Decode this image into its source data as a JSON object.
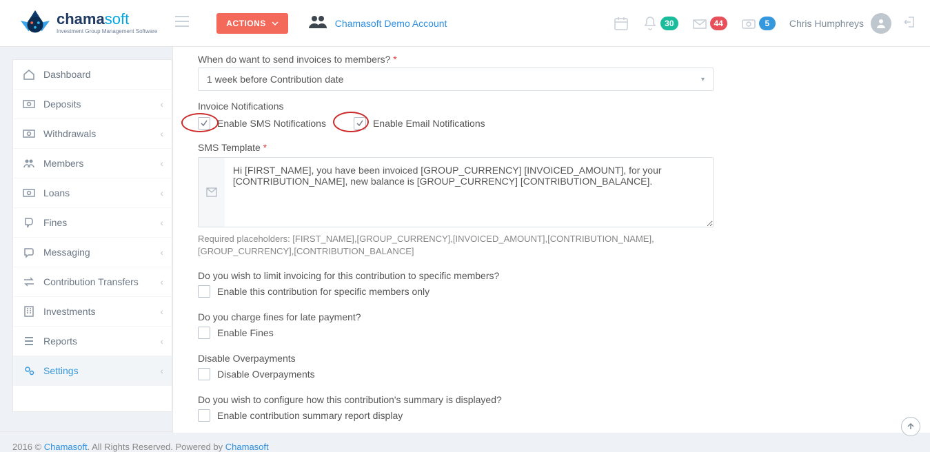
{
  "header": {
    "brand": "chamasoft",
    "brand_sub": "Investment Group Management Software",
    "actions_label": "ACTIONS",
    "account_name": "Chamasoft Demo Account",
    "user_name": "Chris Humphreys",
    "badges": {
      "bell": "30",
      "inbox": "44",
      "wallet": "5"
    }
  },
  "sidebar": {
    "items": [
      {
        "label": "Dashboard"
      },
      {
        "label": "Deposits"
      },
      {
        "label": "Withdrawals"
      },
      {
        "label": "Members"
      },
      {
        "label": "Loans"
      },
      {
        "label": "Fines"
      },
      {
        "label": "Messaging"
      },
      {
        "label": "Contribution Transfers"
      },
      {
        "label": "Investments"
      },
      {
        "label": "Reports"
      },
      {
        "label": "Settings"
      }
    ]
  },
  "form": {
    "when_label": "When do want to send invoices to members?",
    "when_value": "1 week before Contribution date",
    "invoice_notifications_label": "Invoice Notifications",
    "enable_sms_label": "Enable SMS Notifications",
    "enable_email_label": "Enable Email Notifications",
    "sms_template_label": "SMS Template",
    "sms_template_value": "Hi [FIRST_NAME], you have been invoiced [GROUP_CURRENCY] [INVOICED_AMOUNT], for your [CONTRIBUTION_NAME], new balance is [GROUP_CURRENCY] [CONTRIBUTION_BALANCE].",
    "sms_hint": "Required placeholders: [FIRST_NAME],[GROUP_CURRENCY],[INVOICED_AMOUNT],[CONTRIBUTION_NAME],[GROUP_CURRENCY],[CONTRIBUTION_BALANCE]",
    "limit_q": "Do you wish to limit invoicing for this contribution to specific members?",
    "limit_cb": "Enable this contribution for specific members only",
    "fines_q": "Do you charge fines for late payment?",
    "fines_cb": "Enable Fines",
    "over_q": "Disable Overpayments",
    "over_cb": "Disable Overpayments",
    "summary_q": "Do you wish to configure how this contribution's summary is displayed?",
    "summary_cb": "Enable contribution summary report display"
  },
  "footer": {
    "year": "2016 © ",
    "brand": "Chamasoft",
    "mid": ". All Rights Reserved. Powered by ",
    "brand2": "Chamasoft"
  }
}
